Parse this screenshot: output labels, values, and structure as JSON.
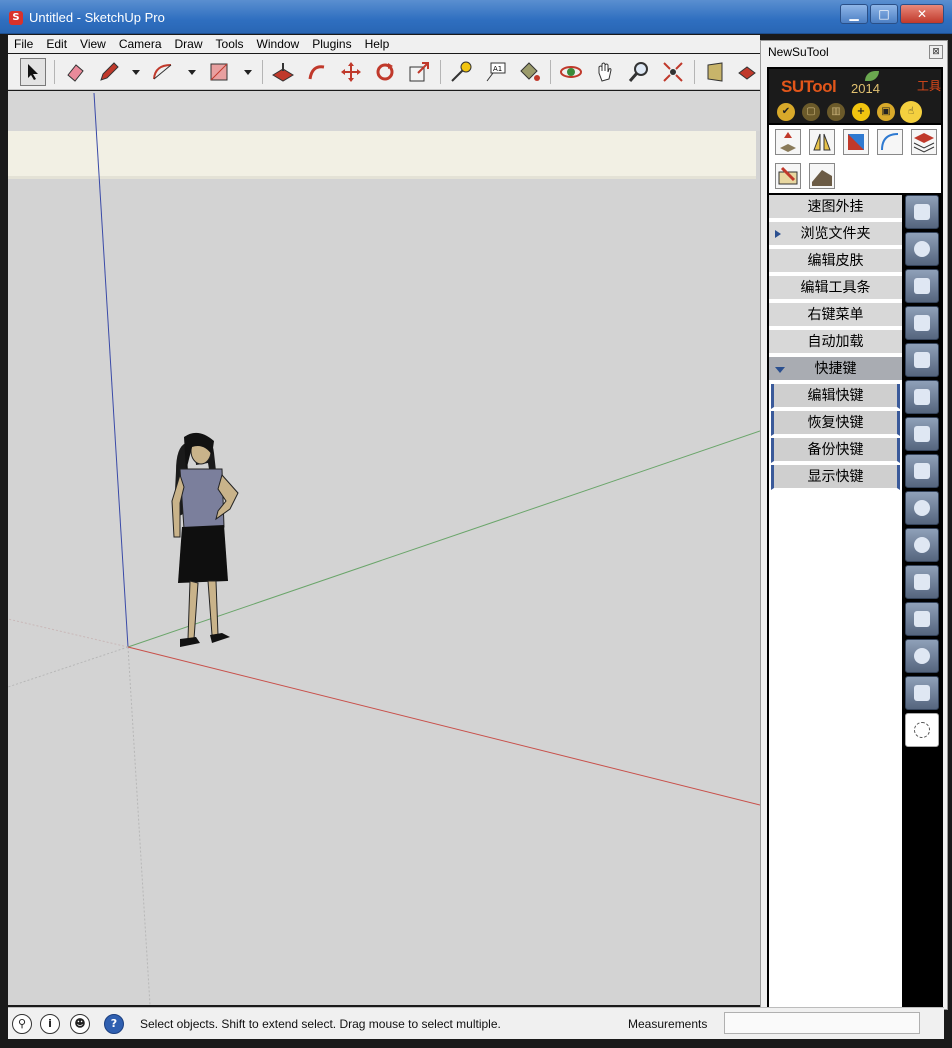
{
  "window": {
    "title": "Untitled - SketchUp Pro",
    "app_icon": "sketchup-logo-icon",
    "buttons": {
      "minimize": "▁",
      "maximize": "□",
      "close": "✕"
    }
  },
  "menu": [
    "File",
    "Edit",
    "View",
    "Camera",
    "Draw",
    "Tools",
    "Window",
    "Plugins",
    "Help"
  ],
  "toolbar": {
    "tools": [
      "select",
      "eraser",
      "pencil",
      "arc",
      "rectangle",
      "push-pull",
      "follow-me",
      "move",
      "rotate",
      "scale",
      "tape-measure",
      "text",
      "paint-bucket",
      "orbit",
      "pan",
      "zoom",
      "zoom-extents",
      "section",
      "component"
    ]
  },
  "status": {
    "message": "Select objects. Shift to extend select. Drag mouse to select multiple.",
    "measurements_label": "Measurements",
    "measurements_value": "",
    "icons": [
      "geo-location-icon",
      "info-icon",
      "user-icon",
      "help-icon"
    ]
  },
  "panel": {
    "title": "NewSuTool",
    "close": "⊠",
    "brand": "SUTool",
    "year": "2014",
    "tool_label": "工具",
    "quick_buttons": [
      "✔",
      "▢",
      "▥",
      "+",
      "▣",
      "☝"
    ],
    "menu": [
      {
        "label": "速图外挂",
        "type": "item"
      },
      {
        "label": "浏览文件夹",
        "type": "item",
        "arrow": "right"
      },
      {
        "label": "编辑皮肤",
        "type": "item"
      },
      {
        "label": "编辑工具条",
        "type": "item"
      },
      {
        "label": "右键菜单",
        "type": "item"
      },
      {
        "label": "自动加载",
        "type": "item"
      },
      {
        "label": "快捷键",
        "type": "selected",
        "arrow": "down"
      },
      {
        "label": "编辑快键",
        "type": "sub"
      },
      {
        "label": "恢复快键",
        "type": "sub"
      },
      {
        "label": "备份快键",
        "type": "sub"
      },
      {
        "label": "显示快键",
        "type": "sub"
      }
    ]
  },
  "colors": {
    "viewport_bg": "#d3d3d3",
    "red_axis": "#c0392b",
    "green_axis": "#5c9b5c",
    "blue_axis": "#2b3a9c",
    "titlebar": "#2f6fc0",
    "brand": "#e2561a"
  }
}
